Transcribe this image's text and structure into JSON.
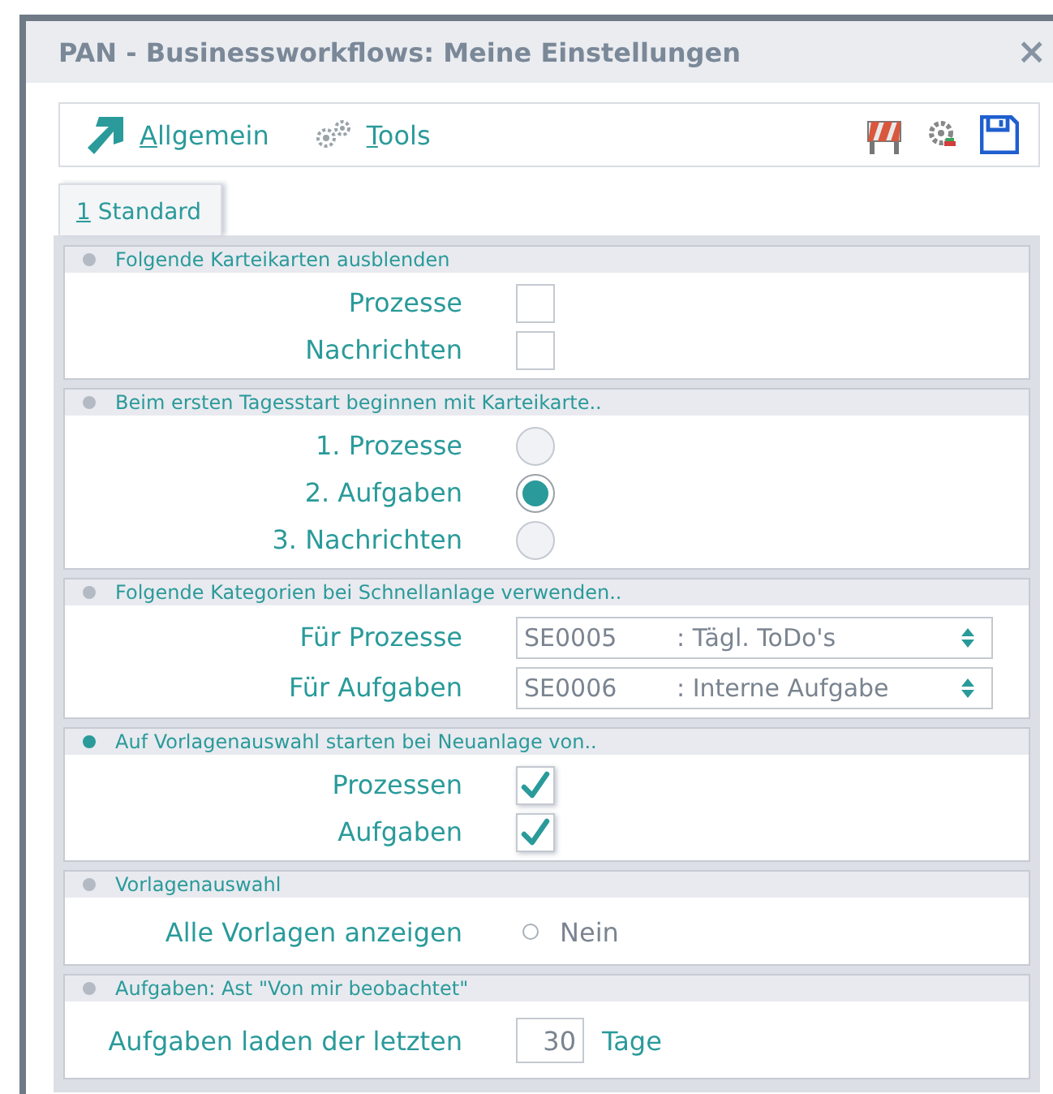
{
  "window": {
    "title": "PAN - Businessworkflows: Meine Einstellungen",
    "close": "×"
  },
  "toolbar": {
    "items": [
      {
        "label": "Allgemein",
        "mnemonic": true
      },
      {
        "label": "Tools",
        "mnemonic": true
      }
    ]
  },
  "tabs": [
    {
      "label": "1 Standard",
      "selected": true,
      "mnemonic": true
    }
  ],
  "sections": [
    {
      "title": "Folgende Karteikarten ausblenden",
      "color": "#b4bac4",
      "rows": [
        {
          "kind": "checkbox",
          "label": "Prozesse",
          "checked": false
        },
        {
          "kind": "checkbox",
          "label": "Nachrichten",
          "checked": false
        }
      ]
    },
    {
      "title": "Beim ersten Tagesstart beginnen mit Karteikarte..",
      "color": "#b4bac4",
      "rows": [
        {
          "kind": "radio",
          "label": "1. Prozesse",
          "selected": false
        },
        {
          "kind": "radio",
          "label": "2. Aufgaben",
          "selected": true
        },
        {
          "kind": "radio",
          "label": "3. Nachrichten",
          "selected": false
        }
      ]
    },
    {
      "title": "Folgende Kategorien bei Schnellanlage verwenden..",
      "color": "#b4bac4",
      "rows": [
        {
          "kind": "select",
          "label": "Für Prozesse",
          "code": "SE0005",
          "value": ": Tägl. ToDo's"
        },
        {
          "kind": "select",
          "label": "Für Aufgaben",
          "code": "SE0006",
          "value": ": Interne Aufgabe"
        }
      ]
    },
    {
      "title": "Auf Vorlagenauswahl starten bei Neuanlage von..",
      "color": "#2a9a9a",
      "rows": [
        {
          "kind": "checkbox",
          "label": "Prozessen",
          "checked": true
        },
        {
          "kind": "checkbox",
          "label": "Aufgaben",
          "checked": true
        }
      ]
    },
    {
      "title": "Vorlagenauswahl",
      "color": "#b4bac4",
      "rows": [
        {
          "kind": "toggle",
          "label": "Alle Vorlagen anzeigen",
          "on": false,
          "value": "Nein"
        }
      ]
    },
    {
      "title": "Aufgaben: Ast \"Von mir beobachtet\"",
      "color": "#b4bac4",
      "rows": [
        {
          "kind": "number",
          "label": "Aufgaben laden der letzten",
          "value": "30",
          "unit": "Tage"
        }
      ]
    }
  ]
}
